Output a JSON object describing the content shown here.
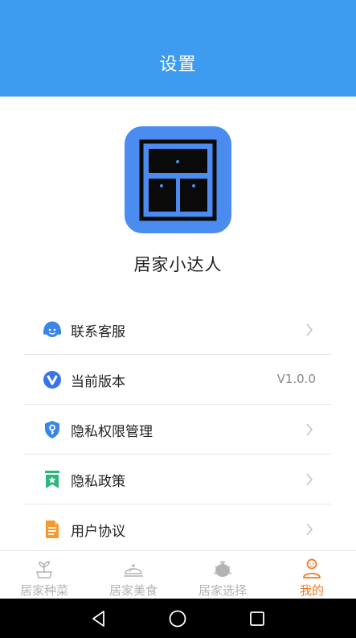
{
  "header": {
    "title": "设置"
  },
  "app": {
    "name": "居家小达人"
  },
  "menu": [
    {
      "label": "联系客服",
      "value": "",
      "icon": "headset-icon"
    },
    {
      "label": "当前版本",
      "value": "V1.0.0",
      "icon": "version-v-icon"
    },
    {
      "label": "隐私权限管理",
      "value": "",
      "icon": "shield-key-icon"
    },
    {
      "label": "隐私政策",
      "value": "",
      "icon": "bookmark-star-icon"
    },
    {
      "label": "用户协议",
      "value": "",
      "icon": "document-icon"
    }
  ],
  "tabs": [
    {
      "label": "居家种菜",
      "icon": "pot-plant-icon",
      "active": false
    },
    {
      "label": "居家美食",
      "icon": "food-cover-icon",
      "active": false
    },
    {
      "label": "居家选择",
      "icon": "durian-icon",
      "active": false
    },
    {
      "label": "我的",
      "icon": "user-icon",
      "active": true
    }
  ],
  "colors": {
    "header": "#3d9bf0",
    "accent": "#f07a22",
    "tab_inactive": "#b3b3b3",
    "app_icon": "#4a8cf0"
  }
}
